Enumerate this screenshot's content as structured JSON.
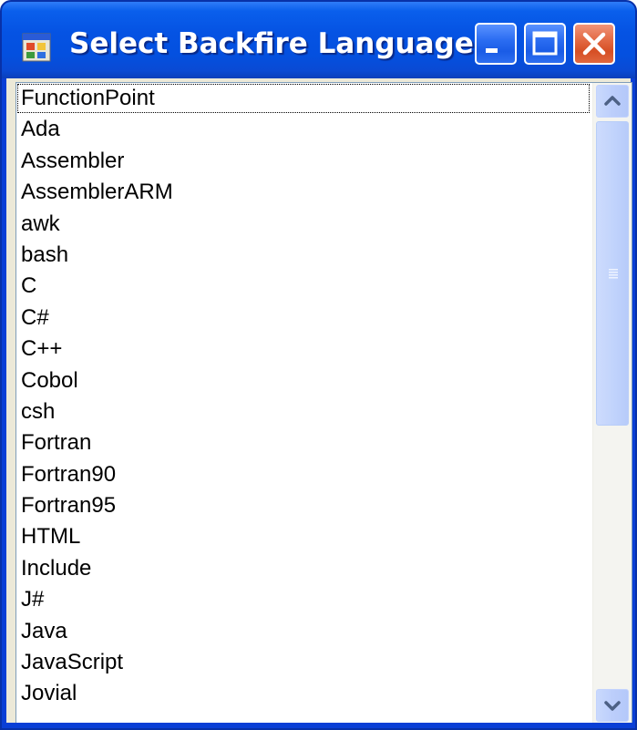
{
  "window": {
    "title": "Select Backfire Language",
    "icon": "application-icon"
  },
  "titlebar_buttons": {
    "minimize": "minimize-icon",
    "maximize": "maximize-icon",
    "close": "close-icon"
  },
  "listbox": {
    "items": [
      "FunctionPoint",
      "Ada",
      "Assembler",
      "AssemblerARM",
      "awk",
      "bash",
      "C",
      "C#",
      "C++",
      "Cobol",
      "csh",
      "Fortran",
      "Fortran90",
      "Fortran95",
      "HTML",
      "Include",
      "J#",
      "Java",
      "JavaScript",
      "Jovial"
    ],
    "focused_item": "FunctionPoint"
  },
  "colors": {
    "titlebar": "#0553e3",
    "close_button": "#d64f25",
    "client_background": "#ece9d8",
    "listbox_border": "#7f9db9",
    "scrollbar_thumb": "#c2d4fc"
  }
}
